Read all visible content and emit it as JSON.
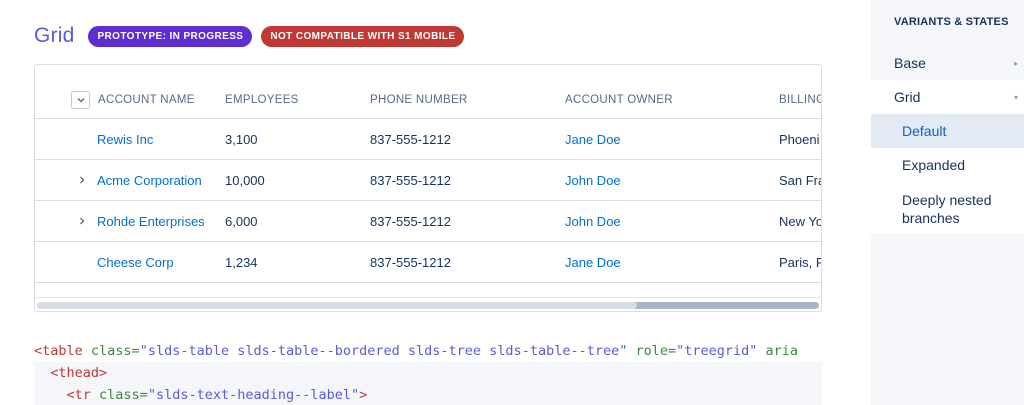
{
  "header": {
    "title": "Grid",
    "badges": [
      "PROTOTYPE: IN PROGRESS",
      "NOT COMPATIBLE WITH S1 MOBILE"
    ]
  },
  "table": {
    "columns": [
      "ACCOUNT NAME",
      "EMPLOYEES",
      "PHONE NUMBER",
      "ACCOUNT OWNER",
      "BILLING"
    ],
    "rows": [
      {
        "expandable": false,
        "name": "Rewis Inc",
        "employees": "3,100",
        "phone": "837-555-1212",
        "owner": "Jane Doe",
        "billing": "Phoeni"
      },
      {
        "expandable": true,
        "name": "Acme Corporation",
        "employees": "10,000",
        "phone": "837-555-1212",
        "owner": "John Doe",
        "billing": "San Fra"
      },
      {
        "expandable": true,
        "name": "Rohde Enterprises",
        "employees": "6,000",
        "phone": "837-555-1212",
        "owner": "John Doe",
        "billing": "New Yo"
      },
      {
        "expandable": false,
        "name": "Cheese Corp",
        "employees": "1,234",
        "phone": "837-555-1212",
        "owner": "Jane Doe",
        "billing": "Paris, F"
      }
    ],
    "expand_icon": "chevron-right-icon",
    "header_toggle_icon": "chevron-down-icon"
  },
  "code": {
    "line1": {
      "tag_open": "<table",
      "attr1": " class=",
      "val1": "\"slds-table slds-table--bordered slds-tree slds-table--tree\"",
      "attr2": " role=",
      "val2": "\"treegrid\"",
      "attr3": " aria"
    },
    "line2": {
      "indent": "  ",
      "tag": "<thead>"
    },
    "line3": {
      "indent": "    ",
      "tag_open": "<tr",
      "attr": " class=",
      "val": "\"slds-text-heading--label\"",
      "close": ">"
    }
  },
  "sidebar": {
    "heading": "VARIANTS & STATES",
    "items": [
      {
        "label": "Base",
        "icon": "triangle-right-icon"
      },
      {
        "label": "Grid",
        "icon": "triangle-down-icon"
      }
    ],
    "subitems": [
      "Default",
      "Expanded",
      "Deeply nested branches"
    ],
    "active_subitem": "Default"
  },
  "colors": {
    "title": "#5a5bd8",
    "badge_purple": "#5f2dd2",
    "badge_red": "#c23934",
    "link": "#0070d2"
  }
}
